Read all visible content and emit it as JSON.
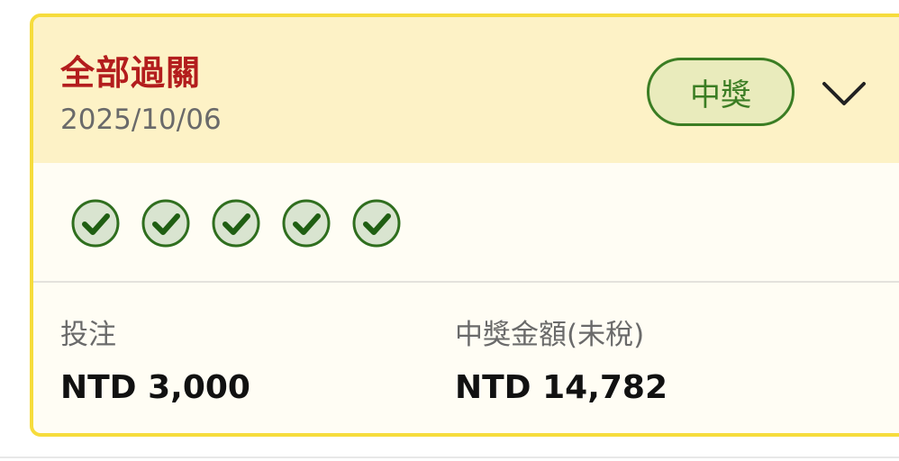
{
  "card": {
    "title": "全部過關",
    "date": "2025/10/06",
    "badge": "中獎",
    "check_count": 5,
    "stake_label": "投注",
    "stake_value": "NTD 3,000",
    "payout_label": "中獎金額(未稅)",
    "payout_value": "NTD 14,782"
  },
  "colors": {
    "border": "#f6dc3c",
    "header_bg": "#fdf2c6",
    "title": "#b31d1d",
    "success_green": "#3b7d23"
  },
  "icons": {
    "expand": "chevron-down-icon",
    "leg_status": "check-circle-icon"
  }
}
